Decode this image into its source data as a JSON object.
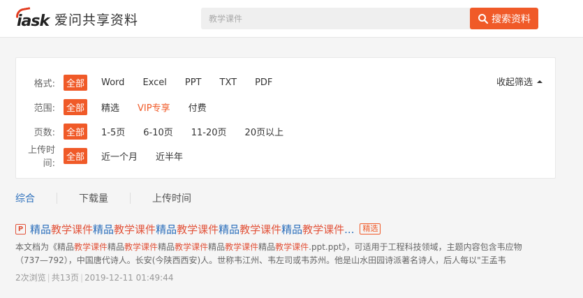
{
  "header": {
    "logo_text": "爱问共享资料",
    "logo_wordmark": "iask",
    "search_placeholder": "教学课件",
    "search_button": "搜索资料"
  },
  "filters": {
    "collapse_label": "收起筛选",
    "rows": [
      {
        "label": "格式:",
        "options": [
          "全部",
          "Word",
          "Excel",
          "PPT",
          "TXT",
          "PDF"
        ]
      },
      {
        "label": "范围:",
        "options": [
          "全部",
          "精选",
          "VIP专享",
          "付费"
        ]
      },
      {
        "label": "页数:",
        "options": [
          "全部",
          "1-5页",
          "6-10页",
          "11-20页",
          "20页以上"
        ]
      },
      {
        "label": "上传时间:",
        "options": [
          "全部",
          "近一个月",
          "近半年"
        ]
      }
    ]
  },
  "sort_tabs": [
    "综合",
    "下载量",
    "上传时间"
  ],
  "result": {
    "file_type": "P",
    "title_parts": [
      "精品",
      "教学课件",
      "精品",
      "教学课件",
      "精品",
      "教学课件",
      "精品",
      "教学课件",
      "精品",
      "教学课件",
      "..."
    ],
    "badge": "精选",
    "desc_line1_parts": [
      "本文档为《精品",
      "教学课件",
      "精品",
      "教学课件",
      "精品",
      "教学课件",
      "精品",
      "教学课件",
      "精品",
      "教学课件",
      ".ppt.ppt》，可适用于工程科技领域，主题内容包含韦应物"
    ],
    "desc_line2": "（737—792），中国唐代诗人。长安(今陕西西安)人。世称韦江州、韦左司或韦苏州。他是山水田园诗派著名诗人，后人每以\"王孟韦",
    "views": "2次浏览",
    "pages": "共13页",
    "date": "2019-12-11 01:49:44"
  },
  "colors": {
    "accent": "#f05a28",
    "link": "#2a6ebb",
    "highlight": "#e2533a"
  }
}
